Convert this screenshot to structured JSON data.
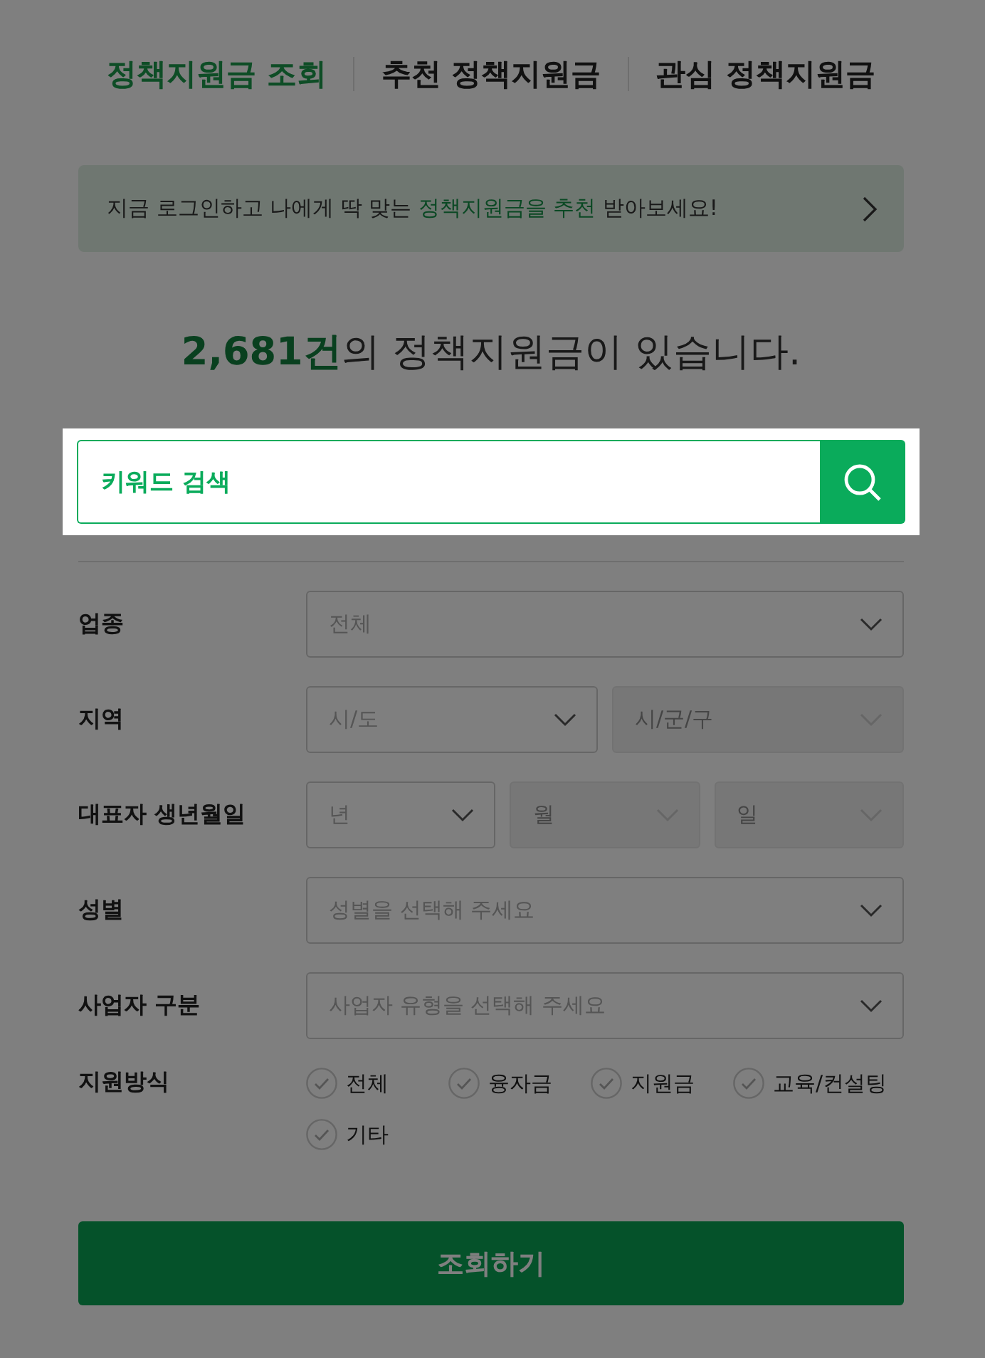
{
  "tabs": [
    {
      "label": "정책지원금 조회",
      "selected": true
    },
    {
      "label": "추천 정책지원금",
      "selected": false
    },
    {
      "label": "관심 정책지원금",
      "selected": false
    }
  ],
  "banner": {
    "text": "지금 로그인하고 나에게 딱 맞는 **정책지원금을 추천** 받아보세요!"
  },
  "summary": {
    "count": "2,681건",
    "text": "의 정책지원금이 있습니다."
  },
  "search": {
    "placeholder": "키워드 검색"
  },
  "filters": [
    {
      "kind": "select",
      "label": "업종",
      "selects": [
        {
          "placeholder": "전체",
          "disabled": false
        }
      ]
    },
    {
      "kind": "select",
      "label": "지역",
      "selects": [
        {
          "placeholder": "시/도",
          "disabled": false
        },
        {
          "placeholder": "시/군/구",
          "disabled": true
        }
      ]
    },
    {
      "kind": "select",
      "label": "대표자 생년월일",
      "selects": [
        {
          "placeholder": "년",
          "disabled": false
        },
        {
          "placeholder": "월",
          "disabled": true
        },
        {
          "placeholder": "일",
          "disabled": true
        }
      ]
    },
    {
      "kind": "select",
      "label": "성별",
      "selects": [
        {
          "placeholder": "성별을 선택해 주세요",
          "disabled": false
        }
      ]
    },
    {
      "kind": "select",
      "label": "사업자 구분",
      "selects": [
        {
          "placeholder": "사업자 유형을 선택해 주세요",
          "disabled": false
        }
      ]
    },
    {
      "kind": "checkboxes",
      "label": "지원방식",
      "options": [
        {
          "label": "전체",
          "checked": false
        },
        {
          "label": "융자금",
          "checked": false
        },
        {
          "label": "지원금",
          "checked": false
        },
        {
          "label": "교육/컨설팅",
          "checked": false
        },
        {
          "label": "기타",
          "checked": false
        }
      ]
    }
  ],
  "submit": {
    "label": "조회하기"
  }
}
